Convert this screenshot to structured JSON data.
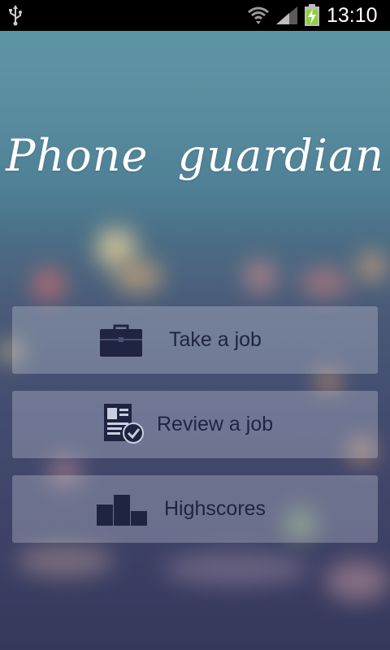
{
  "status_bar": {
    "time": "13:10",
    "icons": [
      "usb-icon",
      "wifi-icon",
      "signal-icon",
      "battery-charging-icon"
    ]
  },
  "app": {
    "title": "Phone  guardian"
  },
  "menu": {
    "take_job": {
      "label": "Take a job",
      "icon": "briefcase-icon"
    },
    "review_job": {
      "label": "Review a job",
      "icon": "document-check-icon"
    },
    "highscores": {
      "label": "Highscores",
      "icon": "podium-icon"
    }
  },
  "colors": {
    "button_text": "#1f2441",
    "battery_fill": "#8bd23c",
    "title_text": "#ffffff"
  }
}
